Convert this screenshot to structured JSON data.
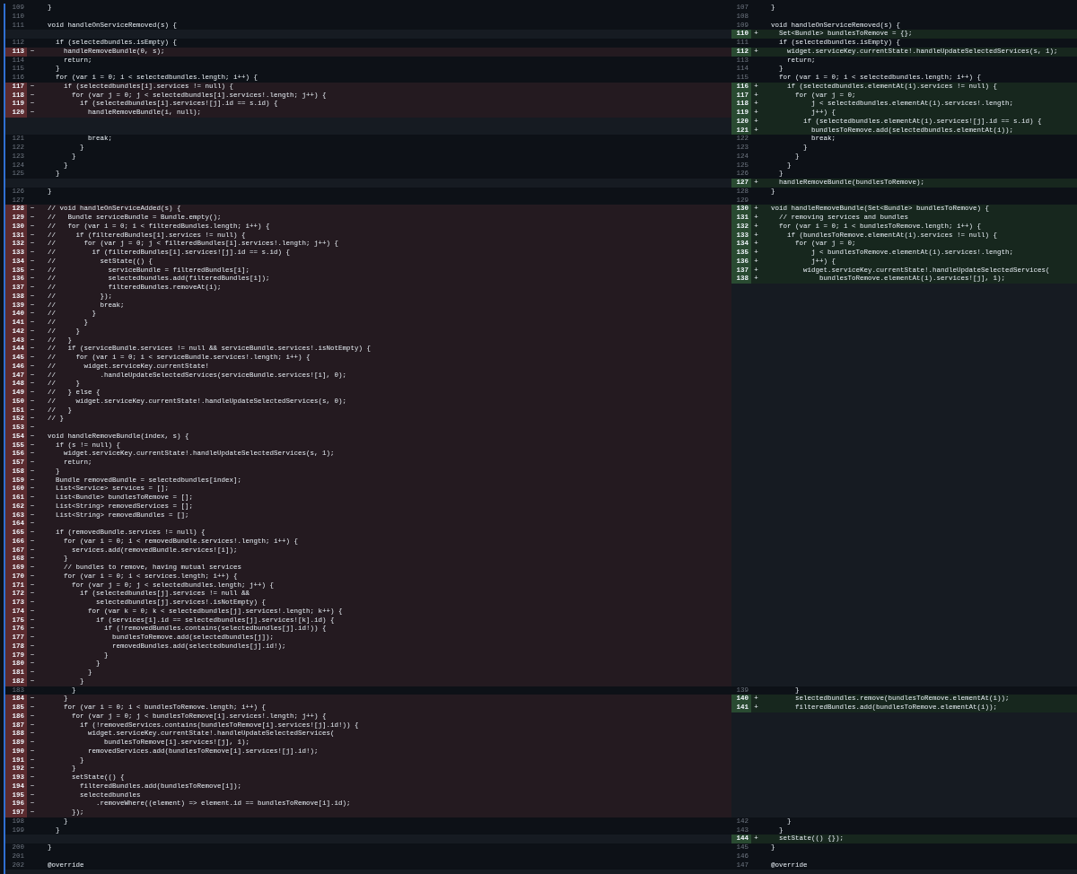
{
  "diff": {
    "rows": [
      {
        "left": {
          "kind": "context",
          "number": "109",
          "code": "  }"
        },
        "right": {
          "kind": "context",
          "number": "107",
          "code": "  }"
        }
      },
      {
        "left": {
          "kind": "context",
          "number": "110"
        },
        "right": {
          "kind": "context",
          "number": "108"
        }
      },
      {
        "left": {
          "kind": "context",
          "number": "111",
          "code": "  void handleOnServiceRemoved(s) {"
        },
        "right": {
          "kind": "context",
          "number": "109",
          "code": "  void handleOnServiceRemoved(s) {"
        }
      },
      {
        "left": {
          "kind": "filler"
        },
        "right": {
          "kind": "added",
          "number": "110",
          "sign": "+",
          "code": "    Set<Bundle> bundlesToRemove = {};"
        }
      },
      {
        "left": {
          "kind": "context",
          "number": "112",
          "code": "    if (selectedbundles.isEmpty) {"
        },
        "right": {
          "kind": "context",
          "number": "111",
          "code": "    if (selectedbundles.isEmpty) {"
        }
      },
      {
        "left": {
          "kind": "deleted",
          "number": "113",
          "sign": "−",
          "code": "      handleRemoveBundle(0, s);"
        },
        "right": {
          "kind": "added",
          "number": "112",
          "sign": "+",
          "code": "      widget.serviceKey.currentState!.handleUpdateSelectedServices(s, 1);"
        }
      },
      {
        "left": {
          "kind": "context",
          "number": "114",
          "code": "      return;"
        },
        "right": {
          "kind": "context",
          "number": "113",
          "code": "      return;"
        }
      },
      {
        "left": {
          "kind": "context",
          "number": "115",
          "code": "    }"
        },
        "right": {
          "kind": "context",
          "number": "114",
          "code": "    }"
        }
      },
      {
        "left": {
          "kind": "context",
          "number": "116",
          "code": "    for (var i = 0; i < selectedbundles.length; i++) {"
        },
        "right": {
          "kind": "context",
          "number": "115",
          "code": "    for (var i = 0; i < selectedbundles.length; i++) {"
        }
      },
      {
        "left": {
          "kind": "deleted",
          "number": "117",
          "sign": "−",
          "code": "      if (selectedbundles[i].services != null) {"
        },
        "right": {
          "kind": "added",
          "number": "116",
          "sign": "+",
          "code": "      if (selectedbundles.elementAt(i).services != null) {"
        }
      },
      {
        "left": {
          "kind": "deleted",
          "number": "118",
          "sign": "−",
          "code": "        for (var j = 0; j < selectedbundles[i].services!.length; j++) {"
        },
        "right": {
          "kind": "added",
          "number": "117",
          "sign": "+",
          "code": "        for (var j = 0;"
        }
      },
      {
        "left": {
          "kind": "deleted",
          "number": "119",
          "sign": "−",
          "code": "          if (selectedbundles[i].services![j].id == s.id) {"
        },
        "right": {
          "kind": "added",
          "number": "118",
          "sign": "+",
          "code": "            j < selectedbundles.elementAt(i).services!.length;"
        }
      },
      {
        "left": {
          "kind": "deleted",
          "number": "120",
          "sign": "−",
          "code": "            handleRemoveBundle(i, null);"
        },
        "right": {
          "kind": "added",
          "number": "119",
          "sign": "+",
          "code": "            j++) {"
        }
      },
      {
        "left": {
          "kind": "filler"
        },
        "right": {
          "kind": "added",
          "number": "120",
          "sign": "+",
          "code": "          if (selectedbundles.elementAt(i).services![j].id == s.id) {"
        }
      },
      {
        "left": {
          "kind": "filler"
        },
        "right": {
          "kind": "added",
          "number": "121",
          "sign": "+",
          "code": "            bundlesToRemove.add(selectedbundles.elementAt(i));"
        }
      },
      {
        "left": {
          "kind": "context",
          "number": "121",
          "code": "            break;"
        },
        "right": {
          "kind": "context",
          "number": "122",
          "code": "            break;"
        }
      },
      {
        "left": {
          "kind": "context",
          "number": "122",
          "code": "          }"
        },
        "right": {
          "kind": "context",
          "number": "123",
          "code": "          }"
        }
      },
      {
        "left": {
          "kind": "context",
          "number": "123",
          "code": "        }"
        },
        "right": {
          "kind": "context",
          "number": "124",
          "code": "        }"
        }
      },
      {
        "left": {
          "kind": "context",
          "number": "124",
          "code": "      }"
        },
        "right": {
          "kind": "context",
          "number": "125",
          "code": "      }"
        }
      },
      {
        "left": {
          "kind": "context",
          "number": "125",
          "code": "    }"
        },
        "right": {
          "kind": "context",
          "number": "126",
          "code": "    }"
        }
      },
      {
        "left": {
          "kind": "filler"
        },
        "right": {
          "kind": "added",
          "number": "127",
          "sign": "+",
          "code": "    handleRemoveBundle(bundlesToRemove);"
        }
      },
      {
        "left": {
          "kind": "context",
          "number": "126",
          "code": "  }"
        },
        "right": {
          "kind": "context",
          "number": "128",
          "code": "  }"
        }
      },
      {
        "left": {
          "kind": "context",
          "number": "127"
        },
        "right": {
          "kind": "context",
          "number": "129"
        }
      },
      {
        "left": {
          "kind": "deleted",
          "number": "128",
          "sign": "−",
          "code": "  // void handleOnServiceAdded(s) {"
        },
        "right": {
          "kind": "added",
          "number": "130",
          "sign": "+",
          "code": "  void handleRemoveBundle(Set<Bundle> bundlesToRemove) {"
        }
      },
      {
        "left": {
          "kind": "deleted",
          "number": "129",
          "sign": "−",
          "code": "  //   Bundle serviceBundle = Bundle.empty();"
        },
        "right": {
          "kind": "added",
          "number": "131",
          "sign": "+",
          "code": "    // removing services and bundles"
        }
      },
      {
        "left": {
          "kind": "deleted",
          "number": "130",
          "sign": "−",
          "code": "  //   for (var i = 0; i < filteredBundles.length; i++) {"
        },
        "right": {
          "kind": "added",
          "number": "132",
          "sign": "+",
          "code": "    for (var i = 0; i < bundlesToRemove.length; i++) {"
        }
      },
      {
        "left": {
          "kind": "deleted",
          "number": "131",
          "sign": "−",
          "code": "  //     if (filteredBundles[i].services != null) {"
        },
        "right": {
          "kind": "added",
          "number": "133",
          "sign": "+",
          "code": "      if (bundlesToRemove.elementAt(i).services != null) {"
        }
      },
      {
        "left": {
          "kind": "deleted",
          "number": "132",
          "sign": "−",
          "code": "  //       for (var j = 0; j < filteredBundles[i].services!.length; j++) {"
        },
        "right": {
          "kind": "added",
          "number": "134",
          "sign": "+",
          "code": "        for (var j = 0;"
        }
      },
      {
        "left": {
          "kind": "deleted",
          "number": "133",
          "sign": "−",
          "code": "  //         if (filteredBundles[i].services![j].id == s.id) {"
        },
        "right": {
          "kind": "added",
          "number": "135",
          "sign": "+",
          "code": "            j < bundlesToRemove.elementAt(i).services!.length;"
        }
      },
      {
        "left": {
          "kind": "deleted",
          "number": "134",
          "sign": "−",
          "code": "  //           setState(() {"
        },
        "right": {
          "kind": "added",
          "number": "136",
          "sign": "+",
          "code": "            j++) {"
        }
      },
      {
        "left": {
          "kind": "deleted",
          "number": "135",
          "sign": "−",
          "code": "  //             serviceBundle = filteredBundles[i];"
        },
        "right": {
          "kind": "added",
          "number": "137",
          "sign": "+",
          "code": "          widget.serviceKey.currentState!.handleUpdateSelectedServices("
        }
      },
      {
        "left": {
          "kind": "deleted",
          "number": "136",
          "sign": "−",
          "code": "  //             selectedbundles.add(filteredBundles[i]);"
        },
        "right": {
          "kind": "added",
          "number": "138",
          "sign": "+",
          "code": "              bundlesToRemove.elementAt(i).services![j], 1);"
        }
      },
      {
        "left": {
          "kind": "deleted",
          "number": "137",
          "sign": "−",
          "code": "  //             filteredBundles.removeAt(i);"
        },
        "right": {
          "kind": "filler"
        }
      },
      {
        "left": {
          "kind": "deleted",
          "number": "138",
          "sign": "−",
          "code": "  //           });"
        },
        "right": {
          "kind": "filler"
        }
      },
      {
        "left": {
          "kind": "deleted",
          "number": "139",
          "sign": "−",
          "code": "  //           break;"
        },
        "right": {
          "kind": "filler"
        }
      },
      {
        "left": {
          "kind": "deleted",
          "number": "140",
          "sign": "−",
          "code": "  //         }"
        },
        "right": {
          "kind": "filler"
        }
      },
      {
        "left": {
          "kind": "deleted",
          "number": "141",
          "sign": "−",
          "code": "  //       }"
        },
        "right": {
          "kind": "filler"
        }
      },
      {
        "left": {
          "kind": "deleted",
          "number": "142",
          "sign": "−",
          "code": "  //     }"
        },
        "right": {
          "kind": "filler"
        }
      },
      {
        "left": {
          "kind": "deleted",
          "number": "143",
          "sign": "−",
          "code": "  //   }"
        },
        "right": {
          "kind": "filler"
        }
      },
      {
        "left": {
          "kind": "deleted",
          "number": "144",
          "sign": "−",
          "code": "  //   if (serviceBundle.services != null && serviceBundle.services!.isNotEmpty) {"
        },
        "right": {
          "kind": "filler"
        }
      },
      {
        "left": {
          "kind": "deleted",
          "number": "145",
          "sign": "−",
          "code": "  //     for (var i = 0; i < serviceBundle.services!.length; i++) {"
        },
        "right": {
          "kind": "filler"
        }
      },
      {
        "left": {
          "kind": "deleted",
          "number": "146",
          "sign": "−",
          "code": "  //       widget.serviceKey.currentState!"
        },
        "right": {
          "kind": "filler"
        }
      },
      {
        "left": {
          "kind": "deleted",
          "number": "147",
          "sign": "−",
          "code": "  //           .handleUpdateSelectedServices(serviceBundle.services![i], 0);"
        },
        "right": {
          "kind": "filler"
        }
      },
      {
        "left": {
          "kind": "deleted",
          "number": "148",
          "sign": "−",
          "code": "  //     }"
        },
        "right": {
          "kind": "filler"
        }
      },
      {
        "left": {
          "kind": "deleted",
          "number": "149",
          "sign": "−",
          "code": "  //   } else {"
        },
        "right": {
          "kind": "filler"
        }
      },
      {
        "left": {
          "kind": "deleted",
          "number": "150",
          "sign": "−",
          "code": "  //     widget.serviceKey.currentState!.handleUpdateSelectedServices(s, 0);"
        },
        "right": {
          "kind": "filler"
        }
      },
      {
        "left": {
          "kind": "deleted",
          "number": "151",
          "sign": "−",
          "code": "  //   }"
        },
        "right": {
          "kind": "filler"
        }
      },
      {
        "left": {
          "kind": "deleted",
          "number": "152",
          "sign": "−",
          "code": "  // }"
        },
        "right": {
          "kind": "filler"
        }
      },
      {
        "left": {
          "kind": "deleted",
          "number": "153",
          "sign": "−"
        },
        "right": {
          "kind": "filler"
        }
      },
      {
        "left": {
          "kind": "deleted",
          "number": "154",
          "sign": "−",
          "code": "  void handleRemoveBundle(index, s) {"
        },
        "right": {
          "kind": "filler"
        }
      },
      {
        "left": {
          "kind": "deleted",
          "number": "155",
          "sign": "−",
          "code": "    if (s != null) {"
        },
        "right": {
          "kind": "filler"
        }
      },
      {
        "left": {
          "kind": "deleted",
          "number": "156",
          "sign": "−",
          "code": "      widget.serviceKey.currentState!.handleUpdateSelectedServices(s, 1);"
        },
        "right": {
          "kind": "filler"
        }
      },
      {
        "left": {
          "kind": "deleted",
          "number": "157",
          "sign": "−",
          "code": "      return;"
        },
        "right": {
          "kind": "filler"
        }
      },
      {
        "left": {
          "kind": "deleted",
          "number": "158",
          "sign": "−",
          "code": "    }"
        },
        "right": {
          "kind": "filler"
        }
      },
      {
        "left": {
          "kind": "deleted",
          "number": "159",
          "sign": "−",
          "code": "    Bundle removedBundle = selectedbundles[index];"
        },
        "right": {
          "kind": "filler"
        }
      },
      {
        "left": {
          "kind": "deleted",
          "number": "160",
          "sign": "−",
          "code": "    List<Service> services = [];"
        },
        "right": {
          "kind": "filler"
        }
      },
      {
        "left": {
          "kind": "deleted",
          "number": "161",
          "sign": "−",
          "code": "    List<Bundle> bundlesToRemove = [];"
        },
        "right": {
          "kind": "filler"
        }
      },
      {
        "left": {
          "kind": "deleted",
          "number": "162",
          "sign": "−",
          "code": "    List<String> removedServices = [];"
        },
        "right": {
          "kind": "filler"
        }
      },
      {
        "left": {
          "kind": "deleted",
          "number": "163",
          "sign": "−",
          "code": "    List<String> removedBundles = [];"
        },
        "right": {
          "kind": "filler"
        }
      },
      {
        "left": {
          "kind": "deleted",
          "number": "164",
          "sign": "−"
        },
        "right": {
          "kind": "filler"
        }
      },
      {
        "left": {
          "kind": "deleted",
          "number": "165",
          "sign": "−",
          "code": "    if (removedBundle.services != null) {"
        },
        "right": {
          "kind": "filler"
        }
      },
      {
        "left": {
          "kind": "deleted",
          "number": "166",
          "sign": "−",
          "code": "      for (var i = 0; i < removedBundle.services!.length; i++) {"
        },
        "right": {
          "kind": "filler"
        }
      },
      {
        "left": {
          "kind": "deleted",
          "number": "167",
          "sign": "−",
          "code": "        services.add(removedBundle.services![i]);"
        },
        "right": {
          "kind": "filler"
        }
      },
      {
        "left": {
          "kind": "deleted",
          "number": "168",
          "sign": "−",
          "code": "      }"
        },
        "right": {
          "kind": "filler"
        }
      },
      {
        "left": {
          "kind": "deleted",
          "number": "169",
          "sign": "−",
          "code": "      // bundles to remove, having mutual services"
        },
        "right": {
          "kind": "filler"
        }
      },
      {
        "left": {
          "kind": "deleted",
          "number": "170",
          "sign": "−",
          "code": "      for (var i = 0; i < services.length; i++) {"
        },
        "right": {
          "kind": "filler"
        }
      },
      {
        "left": {
          "kind": "deleted",
          "number": "171",
          "sign": "−",
          "code": "        for (var j = 0; j < selectedbundles.length; j++) {"
        },
        "right": {
          "kind": "filler"
        }
      },
      {
        "left": {
          "kind": "deleted",
          "number": "172",
          "sign": "−",
          "code": "          if (selectedbundles[j].services != null &&"
        },
        "right": {
          "kind": "filler"
        }
      },
      {
        "left": {
          "kind": "deleted",
          "number": "173",
          "sign": "−",
          "code": "              selectedbundles[j].services!.isNotEmpty) {"
        },
        "right": {
          "kind": "filler"
        }
      },
      {
        "left": {
          "kind": "deleted",
          "number": "174",
          "sign": "−",
          "code": "            for (var k = 0; k < selectedbundles[j].services!.length; k++) {"
        },
        "right": {
          "kind": "filler"
        }
      },
      {
        "left": {
          "kind": "deleted",
          "number": "175",
          "sign": "−",
          "code": "              if (services[i].id == selectedbundles[j].services![k].id) {"
        },
        "right": {
          "kind": "filler"
        }
      },
      {
        "left": {
          "kind": "deleted",
          "number": "176",
          "sign": "−",
          "code": "                if (!removedBundles.contains(selectedbundles[j].id!)) {"
        },
        "right": {
          "kind": "filler"
        }
      },
      {
        "left": {
          "kind": "deleted",
          "number": "177",
          "sign": "−",
          "code": "                  bundlesToRemove.add(selectedbundles[j]);"
        },
        "right": {
          "kind": "filler"
        }
      },
      {
        "left": {
          "kind": "deleted",
          "number": "178",
          "sign": "−",
          "code": "                  removedBundles.add(selectedbundles[j].id!);"
        },
        "right": {
          "kind": "filler"
        }
      },
      {
        "left": {
          "kind": "deleted",
          "number": "179",
          "sign": "−",
          "code": "                }"
        },
        "right": {
          "kind": "filler"
        }
      },
      {
        "left": {
          "kind": "deleted",
          "number": "180",
          "sign": "−",
          "code": "              }"
        },
        "right": {
          "kind": "filler"
        }
      },
      {
        "left": {
          "kind": "deleted",
          "number": "181",
          "sign": "−",
          "code": "            }"
        },
        "right": {
          "kind": "filler"
        }
      },
      {
        "left": {
          "kind": "deleted",
          "number": "182",
          "sign": "−",
          "code": "          }"
        },
        "right": {
          "kind": "filler"
        }
      },
      {
        "left": {
          "kind": "context",
          "number": "183",
          "code": "        }"
        },
        "right": {
          "kind": "context",
          "number": "139",
          "code": "        }"
        }
      },
      {
        "left": {
          "kind": "deleted",
          "number": "184",
          "sign": "−",
          "code": "      }"
        },
        "right": {
          "kind": "added",
          "number": "140",
          "sign": "+",
          "code": "        selectedbundles.remove(bundlesToRemove.elementAt(i));"
        }
      },
      {
        "left": {
          "kind": "deleted",
          "number": "185",
          "sign": "−",
          "code": "      for (var i = 0; i < bundlesToRemove.length; i++) {"
        },
        "right": {
          "kind": "added",
          "number": "141",
          "sign": "+",
          "code": "        filteredBundles.add(bundlesToRemove.elementAt(i));"
        }
      },
      {
        "left": {
          "kind": "deleted",
          "number": "186",
          "sign": "−",
          "code": "        for (var j = 0; j < bundlesToRemove[i].services!.length; j++) {"
        },
        "right": {
          "kind": "filler"
        }
      },
      {
        "left": {
          "kind": "deleted",
          "number": "187",
          "sign": "−",
          "code": "          if (!removedServices.contains(bundlesToRemove[i].services![j].id!)) {"
        },
        "right": {
          "kind": "filler"
        }
      },
      {
        "left": {
          "kind": "deleted",
          "number": "188",
          "sign": "−",
          "code": "            widget.serviceKey.currentState!.handleUpdateSelectedServices("
        },
        "right": {
          "kind": "filler"
        }
      },
      {
        "left": {
          "kind": "deleted",
          "number": "189",
          "sign": "−",
          "code": "                bundlesToRemove[i].services![j], 1);"
        },
        "right": {
          "kind": "filler"
        }
      },
      {
        "left": {
          "kind": "deleted",
          "number": "190",
          "sign": "−",
          "code": "            removedServices.add(bundlesToRemove[i].services![j].id!);"
        },
        "right": {
          "kind": "filler"
        }
      },
      {
        "left": {
          "kind": "deleted",
          "number": "191",
          "sign": "−",
          "code": "          }"
        },
        "right": {
          "kind": "filler"
        }
      },
      {
        "left": {
          "kind": "deleted",
          "number": "192",
          "sign": "−",
          "code": "        }"
        },
        "right": {
          "kind": "filler"
        }
      },
      {
        "left": {
          "kind": "deleted",
          "number": "193",
          "sign": "−",
          "code": "        setState(() {"
        },
        "right": {
          "kind": "filler"
        }
      },
      {
        "left": {
          "kind": "deleted",
          "number": "194",
          "sign": "−",
          "code": "          filteredBundles.add(bundlesToRemove[i]);"
        },
        "right": {
          "kind": "filler"
        }
      },
      {
        "left": {
          "kind": "deleted",
          "number": "195",
          "sign": "−",
          "code": "          selectedbundles"
        },
        "right": {
          "kind": "filler"
        }
      },
      {
        "left": {
          "kind": "deleted",
          "number": "196",
          "sign": "−",
          "code": "              .removeWhere((element) => element.id == bundlesToRemove[i].id);"
        },
        "right": {
          "kind": "filler"
        }
      },
      {
        "left": {
          "kind": "deleted",
          "number": "197",
          "sign": "−",
          "code": "        });"
        },
        "right": {
          "kind": "filler"
        }
      },
      {
        "left": {
          "kind": "context",
          "number": "198",
          "code": "      }"
        },
        "right": {
          "kind": "context",
          "number": "142",
          "code": "      }"
        }
      },
      {
        "left": {
          "kind": "context",
          "number": "199",
          "code": "    }"
        },
        "right": {
          "kind": "context",
          "number": "143",
          "code": "    }"
        }
      },
      {
        "left": {
          "kind": "filler"
        },
        "right": {
          "kind": "added",
          "number": "144",
          "sign": "+",
          "code": "    setState(() {});"
        }
      },
      {
        "left": {
          "kind": "context",
          "number": "200",
          "code": "  }"
        },
        "right": {
          "kind": "context",
          "number": "145",
          "code": "  }"
        }
      },
      {
        "left": {
          "kind": "context",
          "number": "201"
        },
        "right": {
          "kind": "context",
          "number": "146"
        }
      },
      {
        "left": {
          "kind": "context",
          "number": "202",
          "code": "  @override"
        },
        "right": {
          "kind": "context",
          "number": "147",
          "code": "  @override"
        }
      }
    ]
  }
}
